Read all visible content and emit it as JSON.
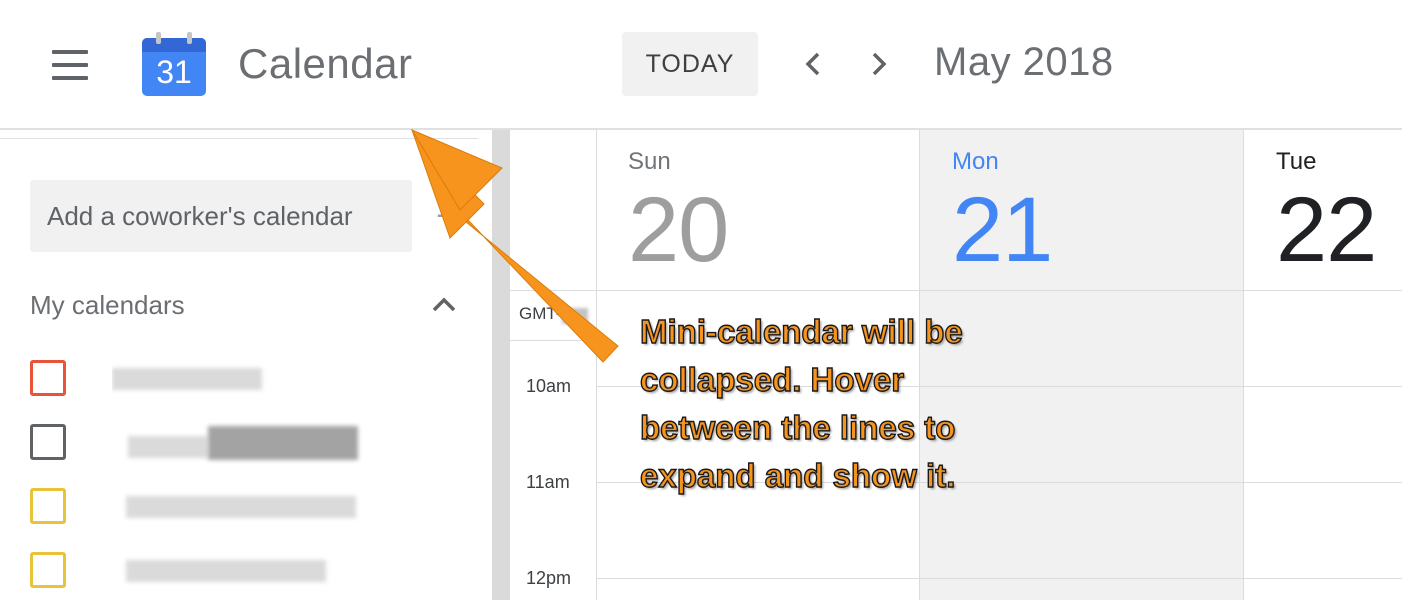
{
  "header": {
    "menu_icon": "hamburger-menu-icon",
    "logo_day": "31",
    "app_title": "Calendar",
    "today_label": "TODAY",
    "prev_icon": "chevron-left-icon",
    "next_icon": "chevron-right-icon",
    "month_label": "May 2018"
  },
  "sidebar": {
    "coworker_placeholder": "Add a coworker's calendar",
    "add_icon": "plus-icon",
    "my_calendars_title": "My calendars",
    "collapse_icon": "chevron-up-icon",
    "calendars": [
      {
        "color": "#e8533a"
      },
      {
        "color": "#5f6368"
      },
      {
        "color": "#e8c33a"
      },
      {
        "color": "#e8c33a"
      }
    ]
  },
  "grid": {
    "timezone_label": "GMT-",
    "days": [
      {
        "name": "Sun",
        "number": "20",
        "state": "past",
        "name_color": "#70757a",
        "number_color": "#9e9e9e"
      },
      {
        "name": "Mon",
        "number": "21",
        "state": "today",
        "name_color": "#4285f4",
        "number_color": "#4285f4"
      },
      {
        "name": "Tue",
        "number": "22",
        "state": "future",
        "name_color": "#202124",
        "number_color": "#202124"
      }
    ],
    "hours": [
      "10am",
      "11am",
      "12pm"
    ]
  },
  "annotation": {
    "text": "Mini-calendar will be\ncollapsed.  Hover\nbetween the lines to\nexpand and show it.",
    "color": "#f7941d"
  }
}
